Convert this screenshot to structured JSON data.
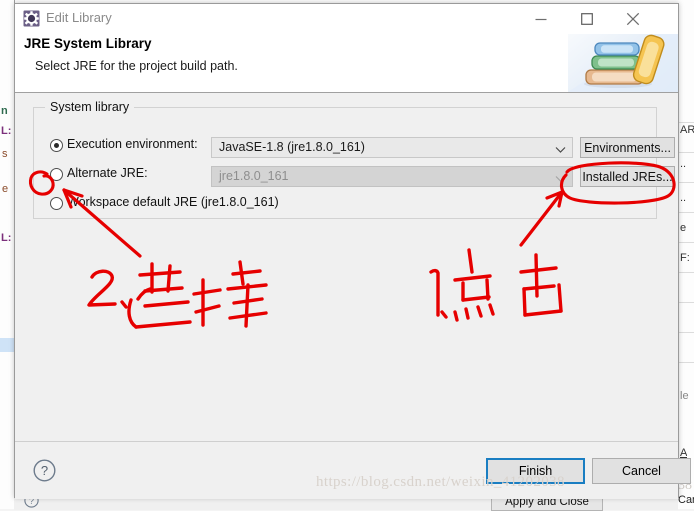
{
  "window": {
    "title": "Edit Library",
    "icon": "library-gear-icon",
    "controls": {
      "minimize": "minimize-icon",
      "maximize": "maximize-icon",
      "close": "close-icon"
    }
  },
  "header": {
    "title": "JRE System Library",
    "description": "Select JRE for the project build path.",
    "graphic": "books-icon"
  },
  "group": {
    "label": "System library",
    "options": [
      {
        "id": "execution-environment",
        "label": "Execution environment:",
        "selected": true,
        "enabled": true,
        "value": "JavaSE-1.8 (jre1.8.0_161)",
        "button": "Environments..."
      },
      {
        "id": "alternate-jre",
        "label": "Alternate JRE:",
        "selected": false,
        "enabled": false,
        "value": "jre1.8.0_161",
        "button": "Installed JREs..."
      },
      {
        "id": "workspace-default-jre",
        "label": "Workspace default JRE (jre1.8.0_161)",
        "selected": false,
        "enabled": true,
        "value": "",
        "button": ""
      }
    ]
  },
  "footer": {
    "help": "?",
    "finish": "Finish",
    "cancel": "Cancel"
  },
  "watermark": "https://blog.csdn.net/weixin_41202038",
  "annotations": {
    "color": "#e60000",
    "step1": {
      "text": "1.点击",
      "target": "Installed JREs... button"
    },
    "step2": {
      "text": "2.选择",
      "target": "Alternate JRE radio button"
    }
  },
  "background": {
    "bottom_buttons": [
      "Apply and Close",
      "Cancel"
    ],
    "left_fragments": [
      "n",
      "L:",
      "s",
      "e",
      "L:"
    ],
    "right_fragments": [
      "AR",
      "..",
      "..",
      "e",
      "F:",
      "le",
      "A",
      "38",
      "Canc"
    ]
  }
}
